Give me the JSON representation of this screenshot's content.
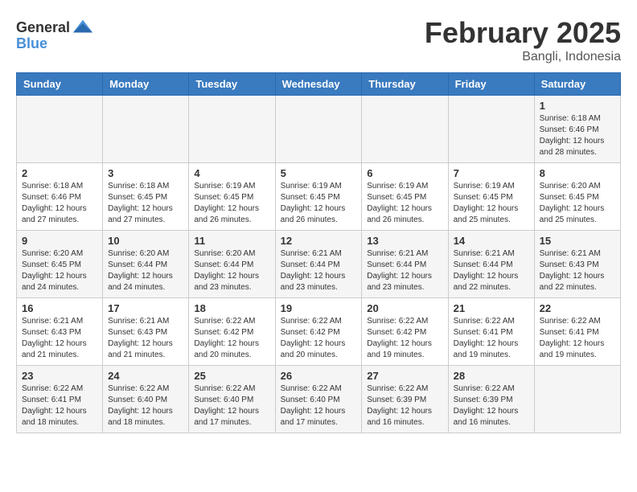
{
  "header": {
    "logo_general": "General",
    "logo_blue": "Blue",
    "month_year": "February 2025",
    "location": "Bangli, Indonesia"
  },
  "days_of_week": [
    "Sunday",
    "Monday",
    "Tuesday",
    "Wednesday",
    "Thursday",
    "Friday",
    "Saturday"
  ],
  "weeks": [
    [
      {
        "day": "",
        "info": ""
      },
      {
        "day": "",
        "info": ""
      },
      {
        "day": "",
        "info": ""
      },
      {
        "day": "",
        "info": ""
      },
      {
        "day": "",
        "info": ""
      },
      {
        "day": "",
        "info": ""
      },
      {
        "day": "1",
        "info": "Sunrise: 6:18 AM\nSunset: 6:46 PM\nDaylight: 12 hours and 28 minutes."
      }
    ],
    [
      {
        "day": "2",
        "info": "Sunrise: 6:18 AM\nSunset: 6:46 PM\nDaylight: 12 hours and 27 minutes."
      },
      {
        "day": "3",
        "info": "Sunrise: 6:18 AM\nSunset: 6:45 PM\nDaylight: 12 hours and 27 minutes."
      },
      {
        "day": "4",
        "info": "Sunrise: 6:19 AM\nSunset: 6:45 PM\nDaylight: 12 hours and 26 minutes."
      },
      {
        "day": "5",
        "info": "Sunrise: 6:19 AM\nSunset: 6:45 PM\nDaylight: 12 hours and 26 minutes."
      },
      {
        "day": "6",
        "info": "Sunrise: 6:19 AM\nSunset: 6:45 PM\nDaylight: 12 hours and 26 minutes."
      },
      {
        "day": "7",
        "info": "Sunrise: 6:19 AM\nSunset: 6:45 PM\nDaylight: 12 hours and 25 minutes."
      },
      {
        "day": "8",
        "info": "Sunrise: 6:20 AM\nSunset: 6:45 PM\nDaylight: 12 hours and 25 minutes."
      }
    ],
    [
      {
        "day": "9",
        "info": "Sunrise: 6:20 AM\nSunset: 6:45 PM\nDaylight: 12 hours and 24 minutes."
      },
      {
        "day": "10",
        "info": "Sunrise: 6:20 AM\nSunset: 6:44 PM\nDaylight: 12 hours and 24 minutes."
      },
      {
        "day": "11",
        "info": "Sunrise: 6:20 AM\nSunset: 6:44 PM\nDaylight: 12 hours and 23 minutes."
      },
      {
        "day": "12",
        "info": "Sunrise: 6:21 AM\nSunset: 6:44 PM\nDaylight: 12 hours and 23 minutes."
      },
      {
        "day": "13",
        "info": "Sunrise: 6:21 AM\nSunset: 6:44 PM\nDaylight: 12 hours and 23 minutes."
      },
      {
        "day": "14",
        "info": "Sunrise: 6:21 AM\nSunset: 6:44 PM\nDaylight: 12 hours and 22 minutes."
      },
      {
        "day": "15",
        "info": "Sunrise: 6:21 AM\nSunset: 6:43 PM\nDaylight: 12 hours and 22 minutes."
      }
    ],
    [
      {
        "day": "16",
        "info": "Sunrise: 6:21 AM\nSunset: 6:43 PM\nDaylight: 12 hours and 21 minutes."
      },
      {
        "day": "17",
        "info": "Sunrise: 6:21 AM\nSunset: 6:43 PM\nDaylight: 12 hours and 21 minutes."
      },
      {
        "day": "18",
        "info": "Sunrise: 6:22 AM\nSunset: 6:42 PM\nDaylight: 12 hours and 20 minutes."
      },
      {
        "day": "19",
        "info": "Sunrise: 6:22 AM\nSunset: 6:42 PM\nDaylight: 12 hours and 20 minutes."
      },
      {
        "day": "20",
        "info": "Sunrise: 6:22 AM\nSunset: 6:42 PM\nDaylight: 12 hours and 19 minutes."
      },
      {
        "day": "21",
        "info": "Sunrise: 6:22 AM\nSunset: 6:41 PM\nDaylight: 12 hours and 19 minutes."
      },
      {
        "day": "22",
        "info": "Sunrise: 6:22 AM\nSunset: 6:41 PM\nDaylight: 12 hours and 19 minutes."
      }
    ],
    [
      {
        "day": "23",
        "info": "Sunrise: 6:22 AM\nSunset: 6:41 PM\nDaylight: 12 hours and 18 minutes."
      },
      {
        "day": "24",
        "info": "Sunrise: 6:22 AM\nSunset: 6:40 PM\nDaylight: 12 hours and 18 minutes."
      },
      {
        "day": "25",
        "info": "Sunrise: 6:22 AM\nSunset: 6:40 PM\nDaylight: 12 hours and 17 minutes."
      },
      {
        "day": "26",
        "info": "Sunrise: 6:22 AM\nSunset: 6:40 PM\nDaylight: 12 hours and 17 minutes."
      },
      {
        "day": "27",
        "info": "Sunrise: 6:22 AM\nSunset: 6:39 PM\nDaylight: 12 hours and 16 minutes."
      },
      {
        "day": "28",
        "info": "Sunrise: 6:22 AM\nSunset: 6:39 PM\nDaylight: 12 hours and 16 minutes."
      },
      {
        "day": "",
        "info": ""
      }
    ]
  ]
}
